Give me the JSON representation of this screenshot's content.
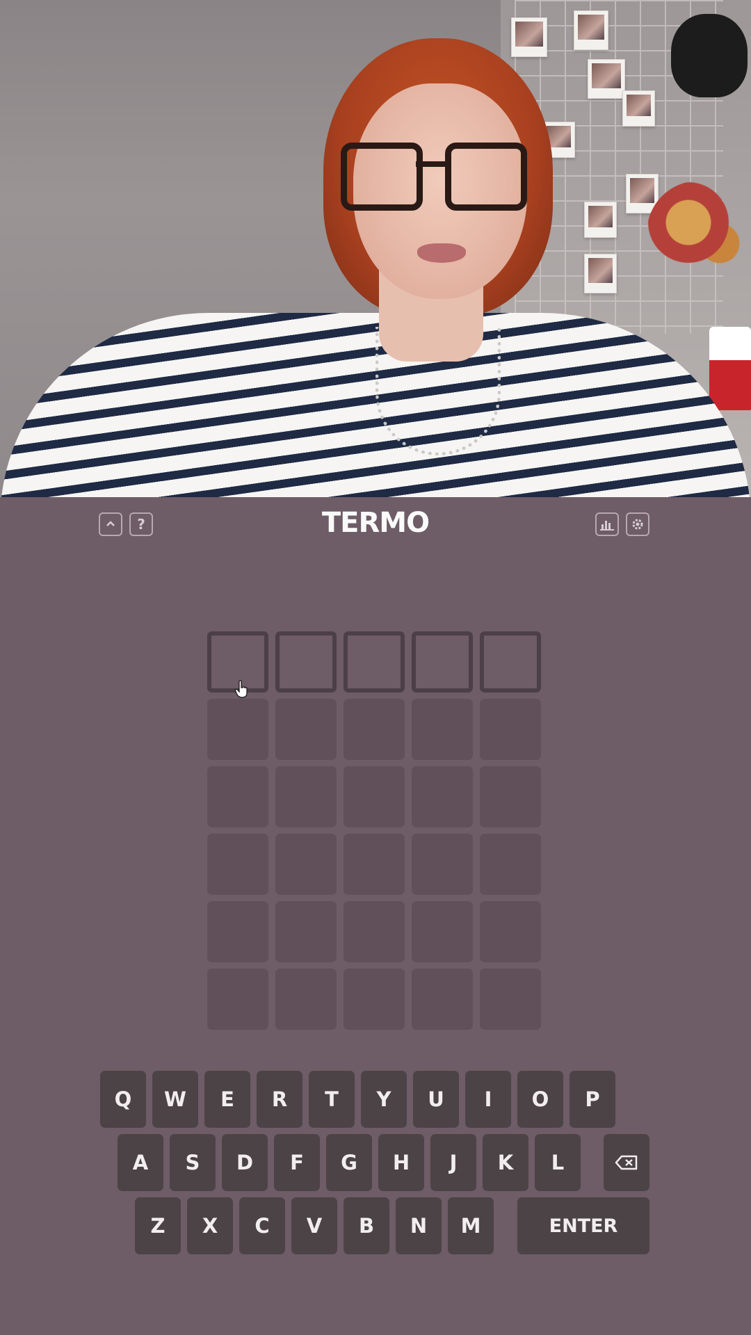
{
  "header": {
    "title": "TERMO",
    "left_icons": [
      "chevron-up-icon",
      "help-icon"
    ],
    "right_icons": [
      "stats-icon",
      "gear-icon"
    ],
    "help_glyph": "?"
  },
  "board": {
    "rows": 6,
    "cols": 5,
    "active_row": 0,
    "letters": [
      [
        "",
        "",
        "",
        "",
        ""
      ],
      [
        "",
        "",
        "",
        "",
        ""
      ],
      [
        "",
        "",
        "",
        "",
        ""
      ],
      [
        "",
        "",
        "",
        "",
        ""
      ],
      [
        "",
        "",
        "",
        "",
        ""
      ],
      [
        "",
        "",
        "",
        "",
        ""
      ]
    ]
  },
  "keyboard": {
    "row1": [
      "Q",
      "W",
      "E",
      "R",
      "T",
      "Y",
      "U",
      "I",
      "O",
      "P"
    ],
    "row2": [
      "A",
      "S",
      "D",
      "F",
      "G",
      "H",
      "J",
      "K",
      "L"
    ],
    "row3": [
      "Z",
      "X",
      "C",
      "V",
      "B",
      "N",
      "M"
    ],
    "enter_label": "ENTER",
    "backspace_icon": "backspace-icon"
  },
  "colors": {
    "background": "#6e5c66",
    "tile_empty": "#615059",
    "key": "#4c4347",
    "text": "#fafafa"
  }
}
